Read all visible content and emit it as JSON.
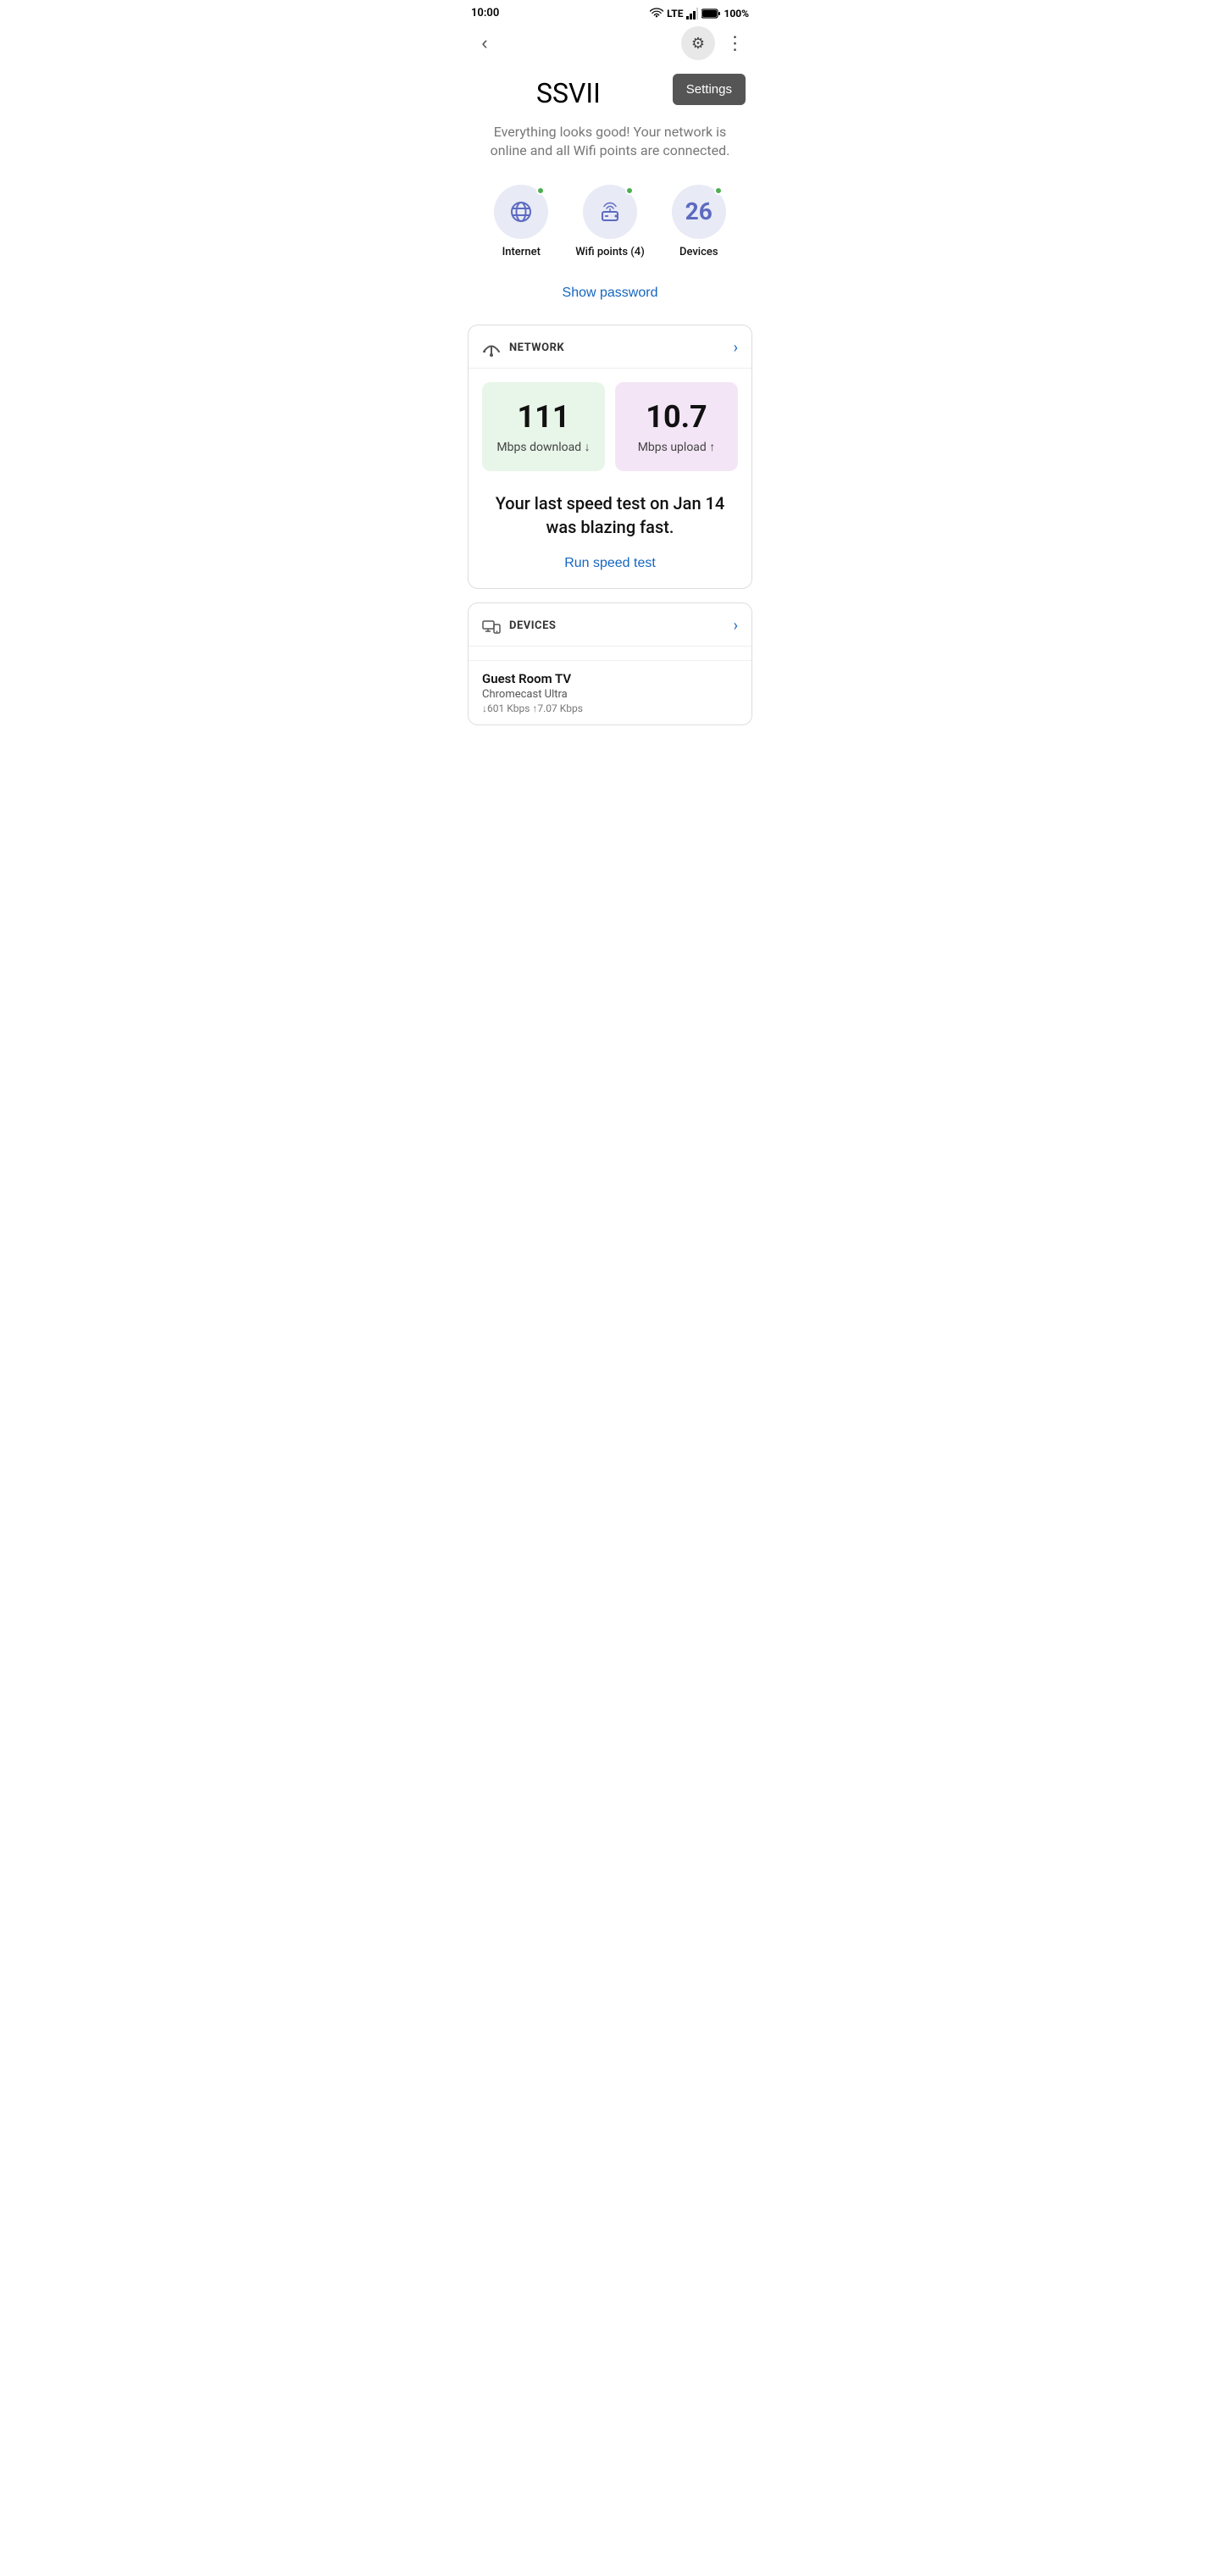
{
  "statusBar": {
    "time": "10:00",
    "battery": "100%",
    "signal": "LTE"
  },
  "topNav": {
    "backIcon": "‹",
    "gearIcon": "⚙",
    "moreIcon": "⋮"
  },
  "header": {
    "networkName": "SSVII",
    "settingsButtonLabel": "Settings",
    "statusMessage": "Everything looks good! Your network is online and all Wifi points are connected."
  },
  "statusIcons": [
    {
      "id": "internet",
      "label": "Internet"
    },
    {
      "id": "wifi",
      "label": "Wifi points (4)"
    },
    {
      "id": "devices",
      "label": "Devices",
      "count": "26"
    }
  ],
  "showPasswordLabel": "Show password",
  "networkCard": {
    "headerTitle": "NETWORK",
    "download": {
      "value": "111",
      "label": "Mbps download ↓"
    },
    "upload": {
      "value": "10.7",
      "label": "Mbps upload ↑"
    },
    "speedTestMessage": "Your last speed test on Jan 14 was blazing fast.",
    "runSpeedTestLabel": "Run speed test"
  },
  "devicesCard": {
    "headerTitle": "DEVICES",
    "items": [
      {
        "name": "Guest Room TV",
        "type": "Chromecast Ultra",
        "speed": "↓601 Kbps   ↑7.07 Kbps"
      }
    ]
  }
}
